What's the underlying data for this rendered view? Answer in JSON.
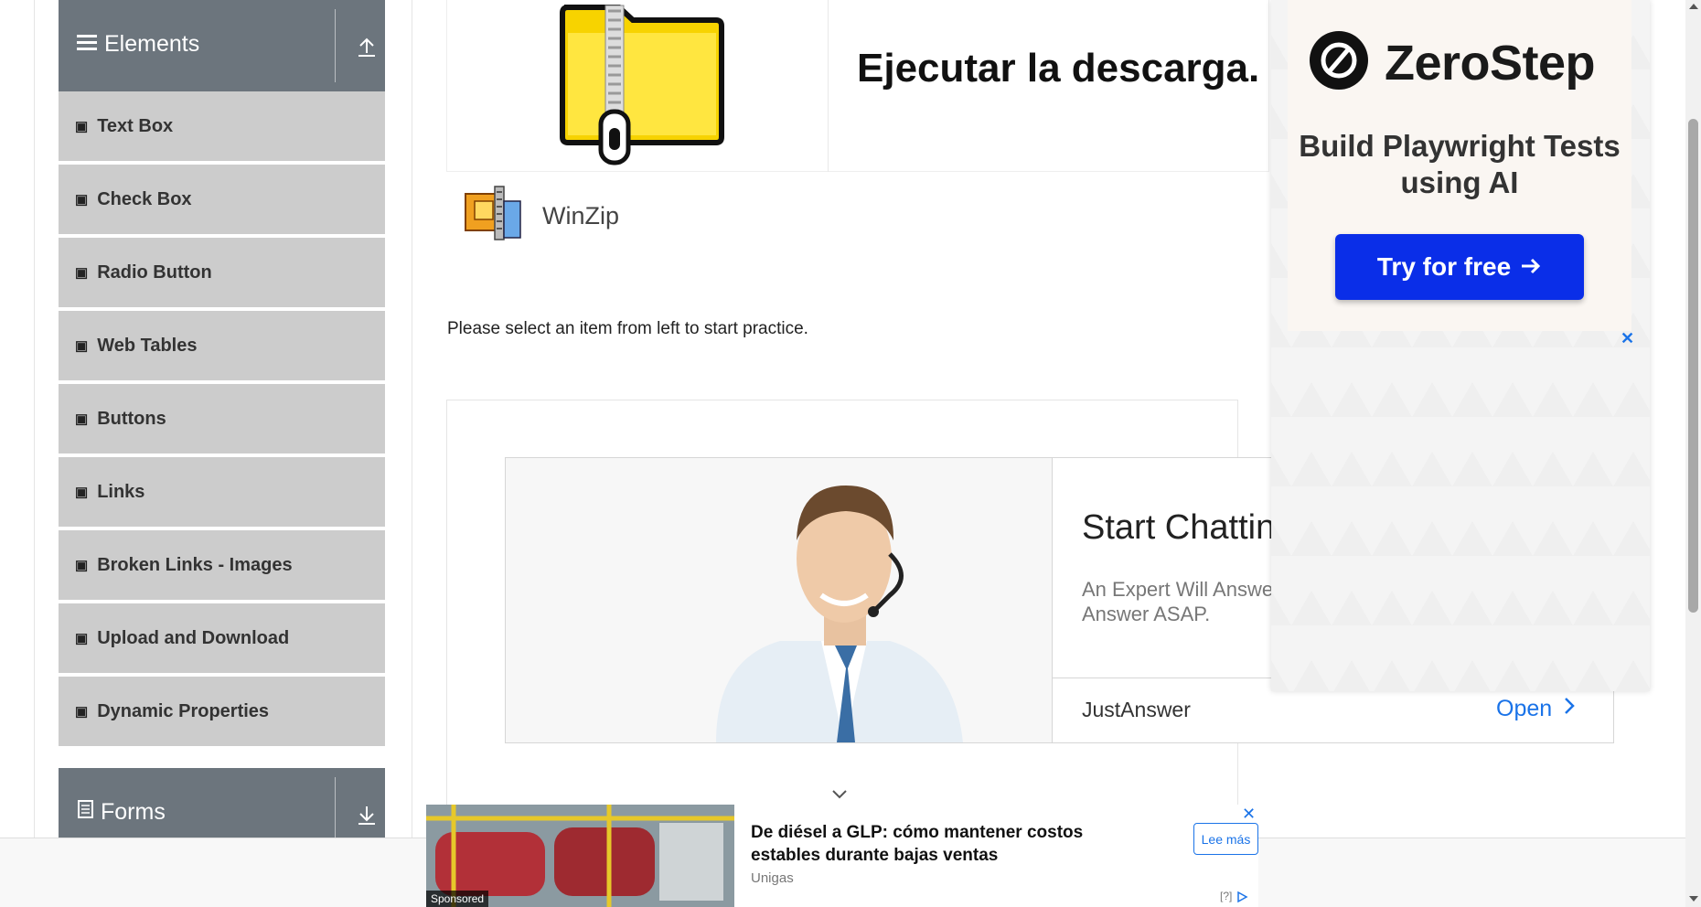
{
  "sidebar": {
    "elements_group": {
      "title": "Elements"
    },
    "items": [
      {
        "label": "Text Box"
      },
      {
        "label": "Check Box"
      },
      {
        "label": "Radio Button"
      },
      {
        "label": "Web Tables"
      },
      {
        "label": "Buttons"
      },
      {
        "label": "Links"
      },
      {
        "label": "Broken Links - Images"
      },
      {
        "label": "Upload and Download"
      },
      {
        "label": "Dynamic Properties"
      }
    ],
    "forms_group": {
      "title": "Forms"
    }
  },
  "download_ad": {
    "headline": "Ejecutar la descarga.",
    "app_name": "WinZip"
  },
  "main": {
    "practice_text": "Please select an item from left to start practice."
  },
  "chat_ad": {
    "headline": "Start Chattin",
    "subtext": "An Expert Will Answe an Answer ASAP.",
    "brand": "JustAnswer",
    "cta": "Open"
  },
  "zerostep_ad": {
    "logo": "ZeroStep",
    "tagline": "Build Playwright Tests using AI",
    "cta": "Try for free",
    "close": "✕"
  },
  "bottom_ad": {
    "sponsored": "Sponsored",
    "headline": "De diésel a GLP: cómo mantener costos estables durante bajas ventas",
    "brand": "Unigas",
    "cta": "Lee más",
    "close": "✕",
    "adchoice": "[?]"
  },
  "colors": {
    "group_header": "#6c757d",
    "menu_item": "#cccccc",
    "zerostep_cta": "#0a2ee8",
    "link_blue": "#1a73e8"
  }
}
